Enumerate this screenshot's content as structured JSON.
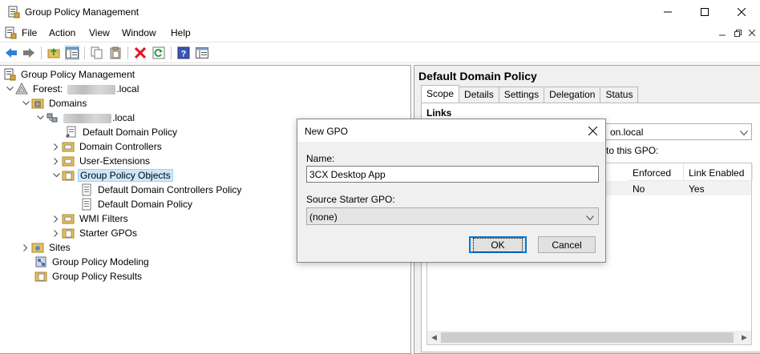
{
  "window": {
    "title": "Group Policy Management",
    "icon": "gpmc-app-icon",
    "controls": [
      "minimize",
      "maximize",
      "close"
    ]
  },
  "menu": {
    "items": [
      "File",
      "Action",
      "View",
      "Window",
      "Help"
    ],
    "mdi_controls": [
      "minimize",
      "restore",
      "close"
    ]
  },
  "toolbar": {
    "buttons": [
      "back-icon",
      "forward-icon",
      "up-folder-icon",
      "show-hide-console-tree-icon",
      "copy-icon",
      "paste-icon",
      "delete-icon",
      "refresh-icon",
      "help-icon",
      "properties-icon"
    ]
  },
  "tree": {
    "root": "Group Policy Management",
    "forest_prefix": "Forest:",
    "forest_suffix": ".local",
    "domains": "Domains",
    "domain_suffix": ".local",
    "default_domain_policy": "Default Domain Policy",
    "domain_controllers": "Domain Controllers",
    "user_extensions": "User-Extensions",
    "gpo_container": "Group Policy Objects",
    "gpo_ddcp": "Default Domain Controllers Policy",
    "gpo_ddp": "Default Domain Policy",
    "wmi_filters": "WMI Filters",
    "starter_gpos": "Starter GPOs",
    "sites": "Sites",
    "modeling": "Group Policy Modeling",
    "results": "Group Policy Results"
  },
  "details": {
    "title": "Default Domain Policy",
    "tabs": [
      "Scope",
      "Details",
      "Settings",
      "Delegation",
      "Status"
    ],
    "active_tab": "Scope",
    "links_heading": "Links",
    "location_value": "on.local",
    "linked_text": "d to this GPO:",
    "columns": [
      "Enforced",
      "Link Enabled"
    ],
    "row": {
      "enforced": "No",
      "link_enabled": "Yes"
    }
  },
  "dialog": {
    "title": "New GPO",
    "name_label": "Name:",
    "name_value": "3CX Desktop App",
    "starter_label": "Source Starter GPO:",
    "starter_value": "(none)",
    "ok_label": "OK",
    "cancel_label": "Cancel"
  },
  "colors": {
    "selection_bg": "#cce8ff",
    "selection_border": "#99d1ff",
    "accent": "#0078d7",
    "delete_red": "#e81123"
  }
}
